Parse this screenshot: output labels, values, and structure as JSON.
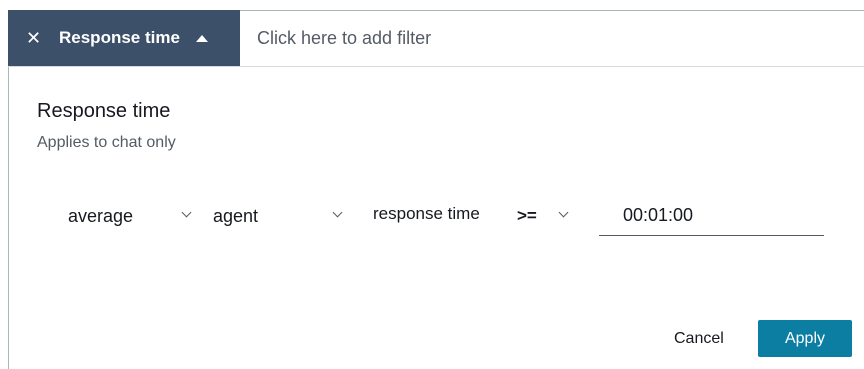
{
  "filter_bar": {
    "token_label": "Response time",
    "close_glyph": "✕",
    "placeholder": "Click here to add filter"
  },
  "panel": {
    "title": "Response time",
    "subtitle": "Applies to chat only"
  },
  "condition": {
    "aggregate": "average",
    "role": "agent",
    "metric": "response time",
    "operator": ">=",
    "value": "00:01:00"
  },
  "actions": {
    "cancel_label": "Cancel",
    "apply_label": "Apply"
  },
  "colors": {
    "token_bg": "#3d5069",
    "apply_bg": "#0c7ea2"
  }
}
